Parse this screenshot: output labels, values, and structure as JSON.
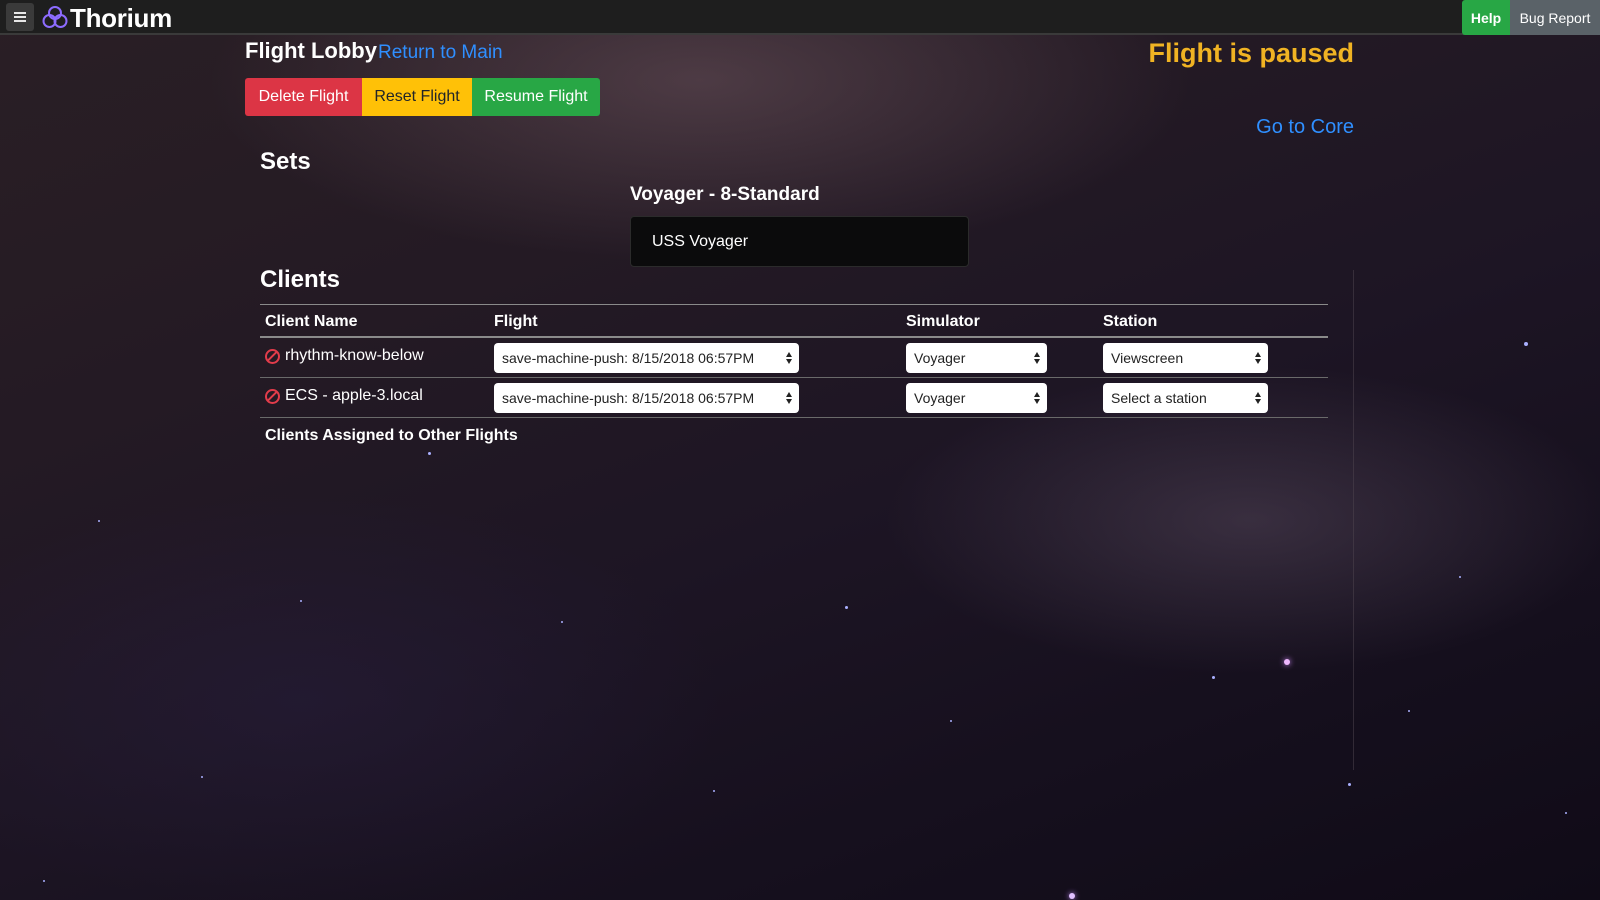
{
  "app": {
    "title": "Thorium"
  },
  "header": {
    "help_label": "Help",
    "bug_report_label": "Bug Report"
  },
  "lobby": {
    "title": "Flight Lobby",
    "return_link": "Return to Main",
    "status": "Flight is paused",
    "core_link": "Go to Core",
    "buttons": {
      "delete": "Delete Flight",
      "reset": "Reset Flight",
      "resume": "Resume Flight"
    }
  },
  "sets": {
    "title": "Sets",
    "set_name": "Voyager - 8-Standard",
    "simulator": "USS Voyager"
  },
  "clients": {
    "title": "Clients",
    "columns": [
      "Client Name",
      "Flight",
      "Simulator",
      "Station"
    ],
    "rows": [
      {
        "name": "rhythm-know-below",
        "flight": "save-machine-push: 8/15/2018 06:57PM",
        "simulator": "Voyager",
        "station": "Viewscreen"
      },
      {
        "name": "ECS - apple-3.local",
        "flight": "save-machine-push: 8/15/2018 06:57PM",
        "simulator": "Voyager",
        "station": "Select a station"
      }
    ],
    "other_flights_title": "Clients Assigned to Other Flights"
  },
  "colors": {
    "accent_link": "#2f8fff",
    "paused": "#f0b323",
    "delete": "#dc3545",
    "reset": "#ffc107",
    "resume": "#28a745",
    "help": "#28a745",
    "bug_report": "#5a6268",
    "status_icon": "#e23c4b"
  },
  "icons": {
    "menu": "hamburger-icon",
    "logo": "thorium-logo-icon",
    "client_status": "blocked-icon",
    "select": "select-arrows-icon"
  }
}
